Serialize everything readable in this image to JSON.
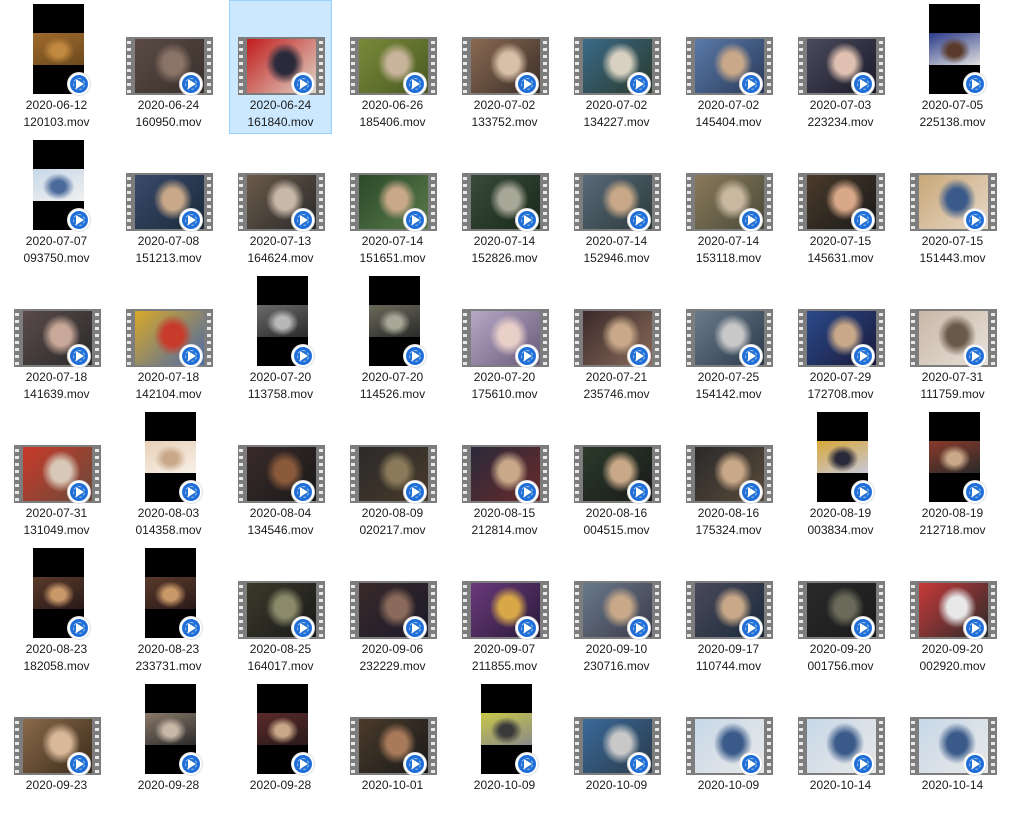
{
  "window": {
    "view": "large-icons",
    "selected_index": 2
  },
  "colors": {
    "selection_bg": "#cce8ff",
    "selection_border": "#99d1ff",
    "badge_blue": "#1f6fd6"
  },
  "files": [
    {
      "date": "2020-06-12",
      "time": "120103.mov",
      "kind": "portrait",
      "colors": [
        "#a06a2c",
        "#c28a40",
        "#6b4a1e"
      ]
    },
    {
      "date": "2020-06-24",
      "time": "160950.mov",
      "kind": "film",
      "colors": [
        "#5a4a44",
        "#8a7468",
        "#3a302c"
      ]
    },
    {
      "date": "2020-06-24",
      "time": "161840.mov",
      "kind": "film",
      "colors": [
        "#c21c1c",
        "#2a2a3a",
        "#e0d6c8"
      ]
    },
    {
      "date": "2020-06-26",
      "time": "185406.mov",
      "kind": "film",
      "colors": [
        "#7a8a3a",
        "#c8b49a",
        "#4a5a22"
      ]
    },
    {
      "date": "2020-07-02",
      "time": "133752.mov",
      "kind": "film",
      "colors": [
        "#8a6a52",
        "#d8c0a8",
        "#3a2e28"
      ]
    },
    {
      "date": "2020-07-02",
      "time": "134227.mov",
      "kind": "film",
      "colors": [
        "#3a6a8a",
        "#d8d0c0",
        "#2a3a2a"
      ]
    },
    {
      "date": "2020-07-02",
      "time": "145404.mov",
      "kind": "film",
      "colors": [
        "#5a7aa8",
        "#c8a888",
        "#2a3a5a"
      ]
    },
    {
      "date": "2020-07-03",
      "time": "223234.mov",
      "kind": "film",
      "colors": [
        "#4a4a5a",
        "#e0c0b0",
        "#1a1a2a"
      ]
    },
    {
      "date": "2020-07-05",
      "time": "225138.mov",
      "kind": "portrait",
      "colors": [
        "#2a3a8a",
        "#5a3a2a",
        "#e0e0e0"
      ]
    },
    {
      "date": "2020-07-07",
      "time": "093750.mov",
      "kind": "portrait",
      "colors": [
        "#c8d8e8",
        "#4a6a9a",
        "#f0f0f0"
      ]
    },
    {
      "date": "2020-07-08",
      "time": "151213.mov",
      "kind": "film",
      "colors": [
        "#3a4a6a",
        "#c8a888",
        "#1a2a3a"
      ]
    },
    {
      "date": "2020-07-13",
      "time": "164624.mov",
      "kind": "film",
      "colors": [
        "#6a5a4a",
        "#c8b8a8",
        "#2a2a2a"
      ]
    },
    {
      "date": "2020-07-14",
      "time": "151651.mov",
      "kind": "film",
      "colors": [
        "#2a4a2a",
        "#c8a888",
        "#5a7a4a"
      ]
    },
    {
      "date": "2020-07-14",
      "time": "152826.mov",
      "kind": "film",
      "colors": [
        "#3a4a3a",
        "#a8a898",
        "#1a2a1a"
      ]
    },
    {
      "date": "2020-07-14",
      "time": "152946.mov",
      "kind": "film",
      "colors": [
        "#5a6a7a",
        "#c8a888",
        "#2a3a3a"
      ]
    },
    {
      "date": "2020-07-14",
      "time": "153118.mov",
      "kind": "film",
      "colors": [
        "#8a7a5a",
        "#c8b8a0",
        "#4a4a3a"
      ]
    },
    {
      "date": "2020-07-15",
      "time": "145631.mov",
      "kind": "film",
      "colors": [
        "#4a3a2a",
        "#d8a888",
        "#1a1a1a"
      ]
    },
    {
      "date": "2020-07-15",
      "time": "151443.mov",
      "kind": "film",
      "colors": [
        "#c8a878",
        "#3a5a8a",
        "#e8d8c8"
      ]
    },
    {
      "date": "2020-07-18",
      "time": "141639.mov",
      "kind": "film",
      "colors": [
        "#5a4a4a",
        "#c8a898",
        "#2a2a2a"
      ]
    },
    {
      "date": "2020-07-18",
      "time": "142104.mov",
      "kind": "film",
      "colors": [
        "#d8a82a",
        "#c83a2a",
        "#4a6aa8"
      ]
    },
    {
      "date": "2020-07-20",
      "time": "113758.mov",
      "kind": "portrait",
      "colors": [
        "#6a6a6a",
        "#b8b8b8",
        "#2a2a2a"
      ]
    },
    {
      "date": "2020-07-20",
      "time": "114526.mov",
      "kind": "portrait",
      "colors": [
        "#6a6a5a",
        "#a8a898",
        "#2a2a2a"
      ]
    },
    {
      "date": "2020-07-20",
      "time": "175610.mov",
      "kind": "film",
      "colors": [
        "#b8a8c8",
        "#e8d0c8",
        "#6a5a7a"
      ]
    },
    {
      "date": "2020-07-21",
      "time": "235746.mov",
      "kind": "film",
      "colors": [
        "#3a2a2a",
        "#c8a888",
        "#8a6a5a"
      ]
    },
    {
      "date": "2020-07-25",
      "time": "154142.mov",
      "kind": "film",
      "colors": [
        "#6a7a8a",
        "#c8c8c8",
        "#2a3a4a"
      ]
    },
    {
      "date": "2020-07-29",
      "time": "172708.mov",
      "kind": "film",
      "colors": [
        "#2a4a8a",
        "#c8a888",
        "#1a1a3a"
      ]
    },
    {
      "date": "2020-07-31",
      "time": "111759.mov",
      "kind": "film",
      "colors": [
        "#c8b8a8",
        "#6a5a4a",
        "#e8e0d8"
      ]
    },
    {
      "date": "2020-07-31",
      "time": "131049.mov",
      "kind": "film",
      "colors": [
        "#c83a2a",
        "#d8c8b8",
        "#6a4a3a"
      ]
    },
    {
      "date": "2020-08-03",
      "time": "014358.mov",
      "kind": "portrait",
      "colors": [
        "#e8d0b8",
        "#c8a888",
        "#f8f0e8"
      ]
    },
    {
      "date": "2020-08-04",
      "time": "134546.mov",
      "kind": "film",
      "colors": [
        "#3a2a2a",
        "#8a5a3a",
        "#1a1a1a"
      ]
    },
    {
      "date": "2020-08-09",
      "time": "020217.mov",
      "kind": "film",
      "colors": [
        "#2a2a2a",
        "#8a7a5a",
        "#4a3a2a"
      ]
    },
    {
      "date": "2020-08-15",
      "time": "212814.mov",
      "kind": "film",
      "colors": [
        "#2a2a3a",
        "#c8a888",
        "#6a2a2a"
      ]
    },
    {
      "date": "2020-08-16",
      "time": "004515.mov",
      "kind": "film",
      "colors": [
        "#2a3a2a",
        "#c8a888",
        "#1a1a1a"
      ]
    },
    {
      "date": "2020-08-16",
      "time": "175324.mov",
      "kind": "film",
      "colors": [
        "#2a2a2a",
        "#c8a888",
        "#5a4a3a"
      ]
    },
    {
      "date": "2020-08-19",
      "time": "003834.mov",
      "kind": "portrait",
      "colors": [
        "#d8a83a",
        "#2a2a3a",
        "#c8c8d8"
      ]
    },
    {
      "date": "2020-08-19",
      "time": "212718.mov",
      "kind": "portrait",
      "colors": [
        "#8a3a2a",
        "#c8a888",
        "#2a2a2a"
      ]
    },
    {
      "date": "2020-08-23",
      "time": "182058.mov",
      "kind": "portrait",
      "colors": [
        "#5a3a2a",
        "#c89868",
        "#2a1a1a"
      ]
    },
    {
      "date": "2020-08-23",
      "time": "233731.mov",
      "kind": "portrait",
      "colors": [
        "#5a3a2a",
        "#c89868",
        "#2a1a1a"
      ]
    },
    {
      "date": "2020-08-25",
      "time": "164017.mov",
      "kind": "film",
      "colors": [
        "#3a3a2a",
        "#8a8a6a",
        "#1a1a1a"
      ]
    },
    {
      "date": "2020-09-06",
      "time": "232229.mov",
      "kind": "film",
      "colors": [
        "#3a2a2a",
        "#8a6a5a",
        "#1a1a2a"
      ]
    },
    {
      "date": "2020-09-07",
      "time": "211855.mov",
      "kind": "film",
      "colors": [
        "#6a3a7a",
        "#d8a848",
        "#2a1a3a"
      ]
    },
    {
      "date": "2020-09-10",
      "time": "230716.mov",
      "kind": "film",
      "colors": [
        "#6a7a8a",
        "#c8a888",
        "#3a3a4a"
      ]
    },
    {
      "date": "2020-09-17",
      "time": "110744.mov",
      "kind": "film",
      "colors": [
        "#4a4a5a",
        "#c8a888",
        "#1a2a3a"
      ]
    },
    {
      "date": "2020-09-20",
      "time": "001756.mov",
      "kind": "film",
      "colors": [
        "#2a2a2a",
        "#6a6a5a",
        "#1a1a1a"
      ]
    },
    {
      "date": "2020-09-20",
      "time": "002920.mov",
      "kind": "film",
      "colors": [
        "#c83a3a",
        "#e8e8e8",
        "#2a2a2a"
      ]
    },
    {
      "date": "2020-09-23",
      "time": "",
      "kind": "film",
      "colors": [
        "#8a6a4a",
        "#d8b898",
        "#3a2a1a"
      ]
    },
    {
      "date": "2020-09-28",
      "time": "",
      "kind": "portrait",
      "colors": [
        "#8a7a6a",
        "#c8b8a8",
        "#2a2a2a"
      ]
    },
    {
      "date": "2020-09-28",
      "time": "",
      "kind": "portrait",
      "colors": [
        "#5a2a2a",
        "#c8a888",
        "#2a1a1a"
      ]
    },
    {
      "date": "2020-10-01",
      "time": "",
      "kind": "film",
      "colors": [
        "#4a3a2a",
        "#a87a5a",
        "#1a1a1a"
      ]
    },
    {
      "date": "2020-10-09",
      "time": "",
      "kind": "portrait",
      "colors": [
        "#c8c848",
        "#3a3a3a",
        "#8a8a8a"
      ]
    },
    {
      "date": "2020-10-09",
      "time": "",
      "kind": "film",
      "colors": [
        "#3a6a9a",
        "#c8c8c8",
        "#2a3a4a"
      ]
    },
    {
      "date": "2020-10-09",
      "time": "",
      "kind": "film",
      "colors": [
        "#c8d8e8",
        "#3a5a8a",
        "#e8e8e8"
      ]
    },
    {
      "date": "2020-10-14",
      "time": "",
      "kind": "film",
      "colors": [
        "#c8d8e8",
        "#3a5a8a",
        "#e8e8e8"
      ]
    },
    {
      "date": "2020-10-14",
      "time": "",
      "kind": "film",
      "colors": [
        "#c8d8e8",
        "#3a5a8a",
        "#e8e8e8"
      ]
    }
  ]
}
